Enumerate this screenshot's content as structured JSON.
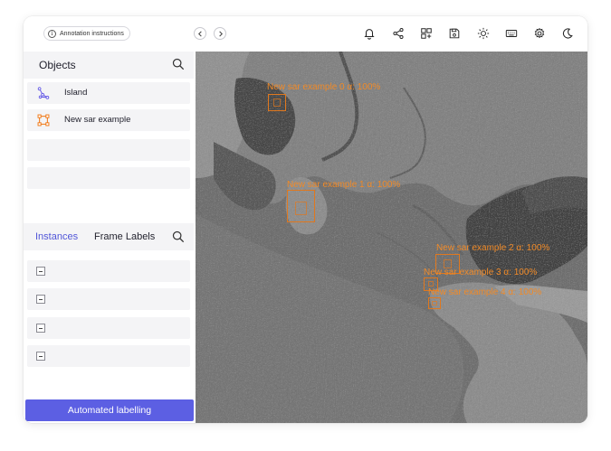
{
  "toolbar": {
    "instructions_label": "Annotation instructions",
    "icons": [
      "bell-icon",
      "share-icon",
      "layout-add-icon",
      "save-icon",
      "brightness-icon",
      "keyboard-icon",
      "settings-icon",
      "dark-mode-icon"
    ]
  },
  "objects": {
    "title": "Objects",
    "items": [
      {
        "label": "Island",
        "icon": "polygon-icon",
        "color": "#6b61e6"
      },
      {
        "label": "New sar example",
        "icon": "bounding-box-icon",
        "color": "#f07a1a"
      }
    ]
  },
  "tabs": {
    "instances": "Instances",
    "frame_labels": "Frame Labels"
  },
  "automated_button": "Automated labelling",
  "annotations": [
    {
      "label": "New sar example 0 α: 100%"
    },
    {
      "label": "New sar example 1 α: 100%"
    },
    {
      "label": "New sar example 2 α: 100%"
    },
    {
      "label": "New sar example 3 α: 100%"
    },
    {
      "label": "New sar example 4 α: 100%"
    }
  ],
  "colors": {
    "accent": "#5c5fe3",
    "annotation": "#e0781e"
  }
}
